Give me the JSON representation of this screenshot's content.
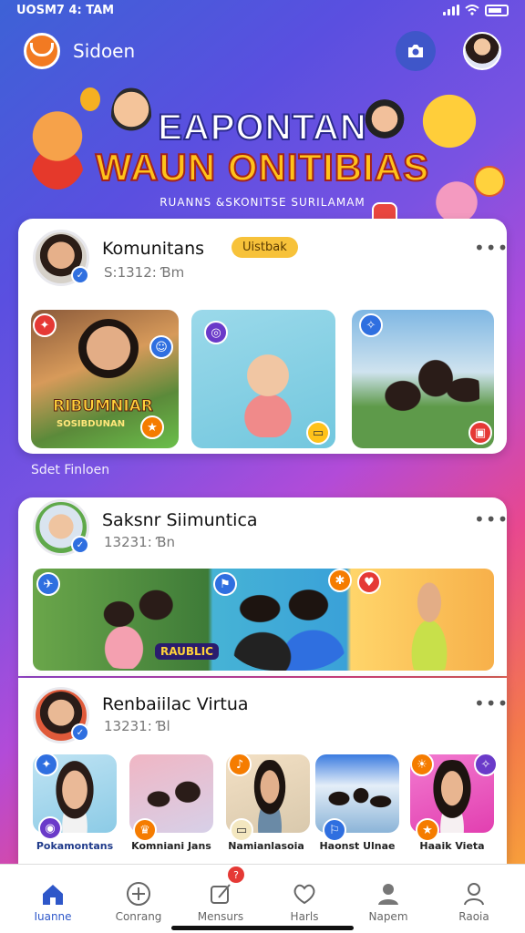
{
  "status_bar": {
    "time": "UOSM7 4: TAM"
  },
  "app_bar": {
    "title": "Sidoen"
  },
  "banner": {
    "line1": "EAPONTAN",
    "line2": "WAUN ONITIBIAS",
    "subtitle": "RUANNS &SKONITSE SURILAMAM"
  },
  "card1": {
    "title": "Komunitans",
    "subtitle": "S:1312: Ɓm",
    "tag": "Uistbak",
    "tile_caption_top": "RIBUMNIAR",
    "tile_caption_bottom": "SOSIBDUNAN"
  },
  "section_label": "Sdet Finloen",
  "card2": {
    "title": "Saksnr Siimuntica",
    "subtitle": "13231: Ɓn",
    "tile_caption": "RAUBLIC"
  },
  "card3": {
    "title": "Renbaiilac Virtua",
    "subtitle": "13231: Ɓl",
    "items": [
      {
        "label": "Pokamontans"
      },
      {
        "label": "Komniani Jans"
      },
      {
        "label": "Namianlasoia"
      },
      {
        "label": "Haonst Ulnae"
      },
      {
        "label": "Haaik Vieta"
      }
    ]
  },
  "tabs": [
    {
      "label": "Iuanne",
      "icon": "home-icon"
    },
    {
      "label": "Conrang",
      "icon": "plus-circle-icon"
    },
    {
      "label": "Mensurs",
      "icon": "message-edit-icon",
      "badge": "?"
    },
    {
      "label": "Harls",
      "icon": "heart-chat-icon"
    },
    {
      "label": "Napem",
      "icon": "person-filled-icon"
    },
    {
      "label": "Raoia",
      "icon": "person-outline-icon"
    }
  ],
  "colors": {
    "accent": "#2e57c9",
    "tag": "#f7c23a",
    "badge_red": "#e53935"
  }
}
